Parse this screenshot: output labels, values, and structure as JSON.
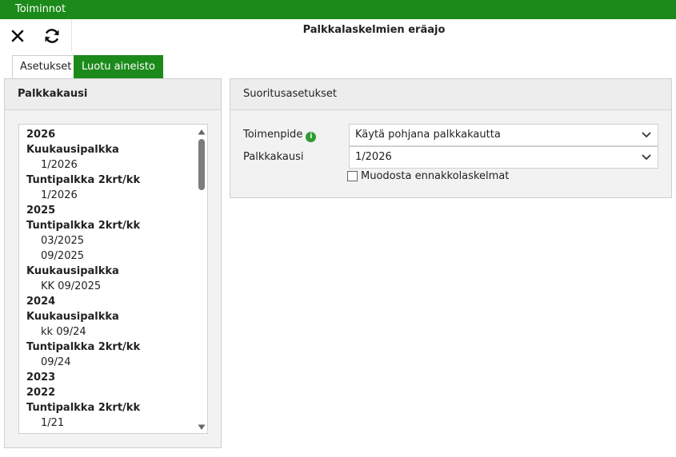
{
  "topbar": {
    "title": "Toiminnot"
  },
  "toolbar": {
    "title": "Palkkalaskelmien eräajo"
  },
  "tabs": [
    {
      "label": "Asetukset"
    },
    {
      "label": "Luotu aineisto"
    }
  ],
  "left_panel": {
    "title": "Palkkakausi",
    "items": [
      {
        "label": "2026",
        "kind": "year"
      },
      {
        "label": "Kuukausipalkka",
        "kind": "type"
      },
      {
        "label": "1/2026",
        "kind": "period"
      },
      {
        "label": "Tuntipalkka 2krt/kk",
        "kind": "type"
      },
      {
        "label": "1/2026",
        "kind": "period"
      },
      {
        "label": "2025",
        "kind": "year"
      },
      {
        "label": "Tuntipalkka 2krt/kk",
        "kind": "type"
      },
      {
        "label": "03/2025",
        "kind": "period"
      },
      {
        "label": "09/2025",
        "kind": "period"
      },
      {
        "label": "Kuukausipalkka",
        "kind": "type"
      },
      {
        "label": "KK 09/2025",
        "kind": "period"
      },
      {
        "label": "2024",
        "kind": "year"
      },
      {
        "label": "Kuukausipalkka",
        "kind": "type"
      },
      {
        "label": "kk 09/24",
        "kind": "period"
      },
      {
        "label": "Tuntipalkka 2krt/kk",
        "kind": "type"
      },
      {
        "label": "09/24",
        "kind": "period"
      },
      {
        "label": "2023",
        "kind": "year"
      },
      {
        "label": "2022",
        "kind": "year"
      },
      {
        "label": "Tuntipalkka 2krt/kk",
        "kind": "type"
      },
      {
        "label": "1/21",
        "kind": "period"
      }
    ]
  },
  "right_panel": {
    "title": "Suoritusasetukset",
    "action_label": "Toimenpide",
    "action_value": "Käytä pohjana palkkakautta",
    "period_label": "Palkkakausi",
    "period_value": "1/2026",
    "advance_checkbox_label": "Muodosta ennakkolaskelmat",
    "advance_checked": false
  },
  "colors": {
    "brand_green": "#1b8a1b",
    "info_green": "#2f9a2f"
  },
  "icons": [
    "close-icon",
    "refresh-icon",
    "info-icon",
    "chevron-down-icon",
    "scroll-up-icon",
    "scroll-down-icon"
  ]
}
